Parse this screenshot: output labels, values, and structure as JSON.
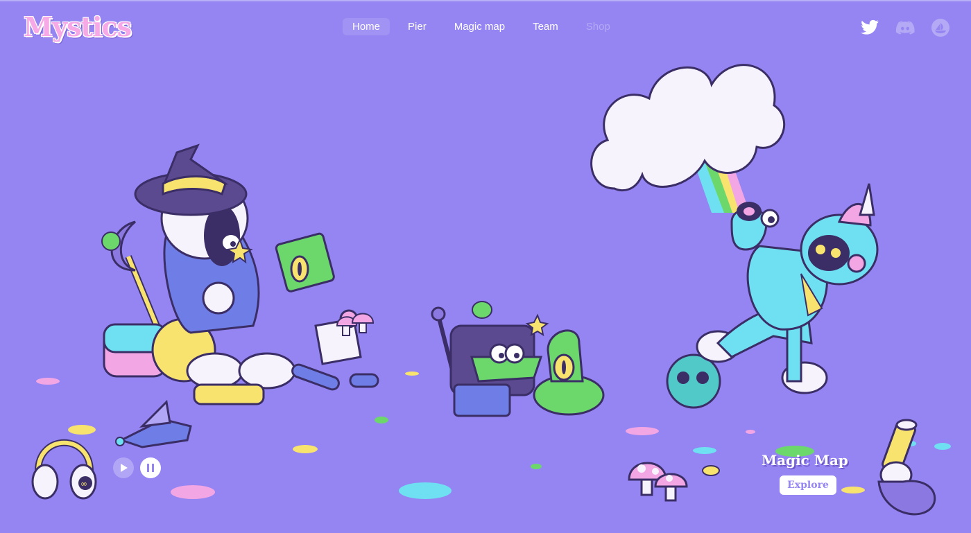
{
  "header": {
    "logo_text": "Mystics",
    "nav": [
      {
        "label": "Home",
        "state": "active"
      },
      {
        "label": "Pier",
        "state": "normal"
      },
      {
        "label": "Magic map",
        "state": "normal"
      },
      {
        "label": "Team",
        "state": "normal"
      },
      {
        "label": "Shop",
        "state": "disabled"
      }
    ],
    "social_icons": [
      "twitter-icon",
      "discord-icon",
      "opensea-icon"
    ]
  },
  "audio": {
    "controls": [
      "play-icon",
      "pause-icon"
    ]
  },
  "promo": {
    "title": "Magic Map",
    "button_label": "Explore"
  },
  "colors": {
    "background": "#9485f2",
    "accent_pink": "#f7a8e6",
    "white": "#ffffff",
    "nav_disabled": "#b4a9f5"
  }
}
